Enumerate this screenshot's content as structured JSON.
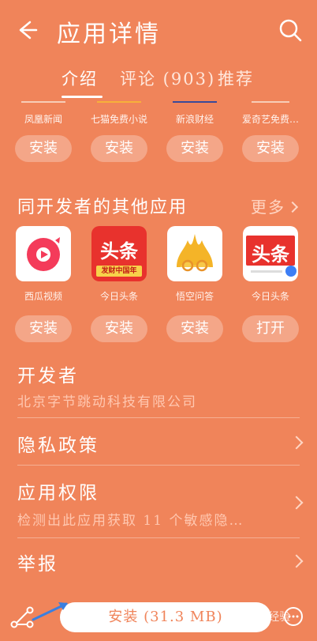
{
  "header": {
    "title": "应用详情",
    "back_icon": "back-arrow-icon",
    "search_icon": "search-icon"
  },
  "tabs": [
    {
      "label": "介绍",
      "active": true
    },
    {
      "label": "评论 (903)",
      "active": false
    },
    {
      "label": "推荐",
      "active": false
    }
  ],
  "top_apps": [
    {
      "name": "凤凰新闻",
      "button": "安装"
    },
    {
      "name": "七猫免费小说",
      "button": "安装"
    },
    {
      "name": "新浪财经",
      "button": "安装"
    },
    {
      "name": "爱奇艺免费…",
      "button": "安装"
    }
  ],
  "same_dev": {
    "title": "同开发者的其他应用",
    "more_label": "更多",
    "apps": [
      {
        "name": "西瓜视频",
        "button": "安装",
        "icon": "xigua-video-icon"
      },
      {
        "name": "今日头条",
        "button": "安装",
        "icon": "toutiao-icon",
        "icon_text": "头条",
        "icon_sub": "发财中国年"
      },
      {
        "name": "悟空问答",
        "button": "安装",
        "icon": "wukong-qa-icon"
      },
      {
        "name": "今日头条",
        "button": "打开",
        "icon": "toutiao-lite-icon",
        "icon_text": "头条"
      }
    ]
  },
  "developer": {
    "label": "开发者",
    "value": "北京字节跳动科技有限公司"
  },
  "privacy": {
    "label": "隐私政策"
  },
  "permissions": {
    "label": "应用权限",
    "value": "检测出此应用获取 11 个敏感隐…"
  },
  "report": {
    "label": "举报"
  },
  "bottom": {
    "install_label": "安装 (31.3 MB)",
    "watermark": "Baidu 经验"
  },
  "colors": {
    "background": "#f0845a",
    "button_text": "#f0845a",
    "toutiao_red": "#e8322d"
  }
}
